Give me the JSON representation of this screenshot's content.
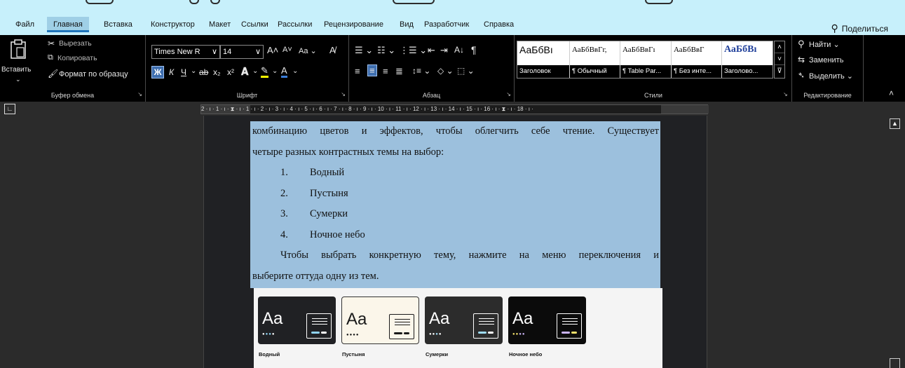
{
  "menu": {
    "tabs": [
      "Файл",
      "Главная",
      "Вставка",
      "Конструктор",
      "Макет",
      "Ссылки",
      "Рассылки",
      "Рецензирование",
      "Вид",
      "Разработчик",
      "Справка"
    ],
    "active_tab": "Главная",
    "share_label": "Поделиться"
  },
  "clipboard": {
    "paste_label": "Вставить",
    "cut_label": "Вырезать",
    "copy_label": "Копировать",
    "format_painter_label": "Формат по образцу",
    "group_label": "Буфер обмена"
  },
  "font": {
    "font_name": "Times New R",
    "font_size": "14",
    "group_label": "Шрифт",
    "case_label": "Aa",
    "bold_label": "Ж",
    "italic_label": "К",
    "underline_label": "Ч"
  },
  "paragraph": {
    "group_label": "Абзац"
  },
  "styles": {
    "items": [
      {
        "sample": "АаБбВı",
        "name": "Заголовок"
      },
      {
        "sample": "АаБбВвГг,",
        "name": "¶ Обычный"
      },
      {
        "sample": "АаБбВвГı",
        "name": "¶ Table Par..."
      },
      {
        "sample": "АаБбВвГ",
        "name": "¶ Без инте..."
      },
      {
        "sample": "АаБбВı",
        "name": "Заголово..."
      }
    ],
    "group_label": "Стили"
  },
  "editing": {
    "find_label": "Найти",
    "replace_label": "Заменить",
    "select_label": "Выделить",
    "group_label": "Редактирование"
  },
  "ruler": {
    "ticks": "2 · ı · 1 · ı · ⧗ · ı · 1 · ı · 2 · ı · 3 · ı · 4 · ı · 5 · ı · 6 · ı · 7 · ı · 8 · ı · 9 · ı · 10 · ı · 11 · ı · 12 · ı · 13 · ı · 14 · ı · 15 · ı · 16 · ı · ⧗ · ı · 18 · ı ·"
  },
  "document": {
    "line1": "комбинацию цветов и эффектов, чтобы облегчить себе чтение. Существует",
    "line2": "четыре разных контрастных темы на выбор:",
    "list": [
      {
        "num": "1.",
        "text": "Водный"
      },
      {
        "num": "2.",
        "text": "Пустыня"
      },
      {
        "num": "3.",
        "text": "Сумерки"
      },
      {
        "num": "4.",
        "text": "Ночное небо"
      }
    ],
    "para2_line1": "Чтобы выбрать конкретную тему, нажмите на меню переключения и",
    "para2_line2": "выберите оттуда одну из тем.",
    "themes": [
      {
        "label": "Водный",
        "sample": "Aa",
        "bg": "#202124",
        "fg": "#ffffff",
        "accent": "#8fd3f3"
      },
      {
        "label": "Пустыня",
        "sample": "Aa",
        "bg": "#fbf6ea",
        "fg": "#1a1a1a",
        "accent": "#1a1a1a"
      },
      {
        "label": "Сумерки",
        "sample": "Aa",
        "bg": "#2c2c2c",
        "fg": "#ffffff",
        "accent": "#9fdcf6"
      },
      {
        "label": "Ночное небо",
        "sample": "Aa",
        "bg": "#0b0b0b",
        "fg": "#ffffff",
        "accent": "#c9b3f5"
      }
    ]
  },
  "colors": {
    "accent": "#1e75bb",
    "selection": "#9cc0dd",
    "ribbon_bg": "#000000",
    "tab_bar_bg": "#c7f0fb"
  }
}
